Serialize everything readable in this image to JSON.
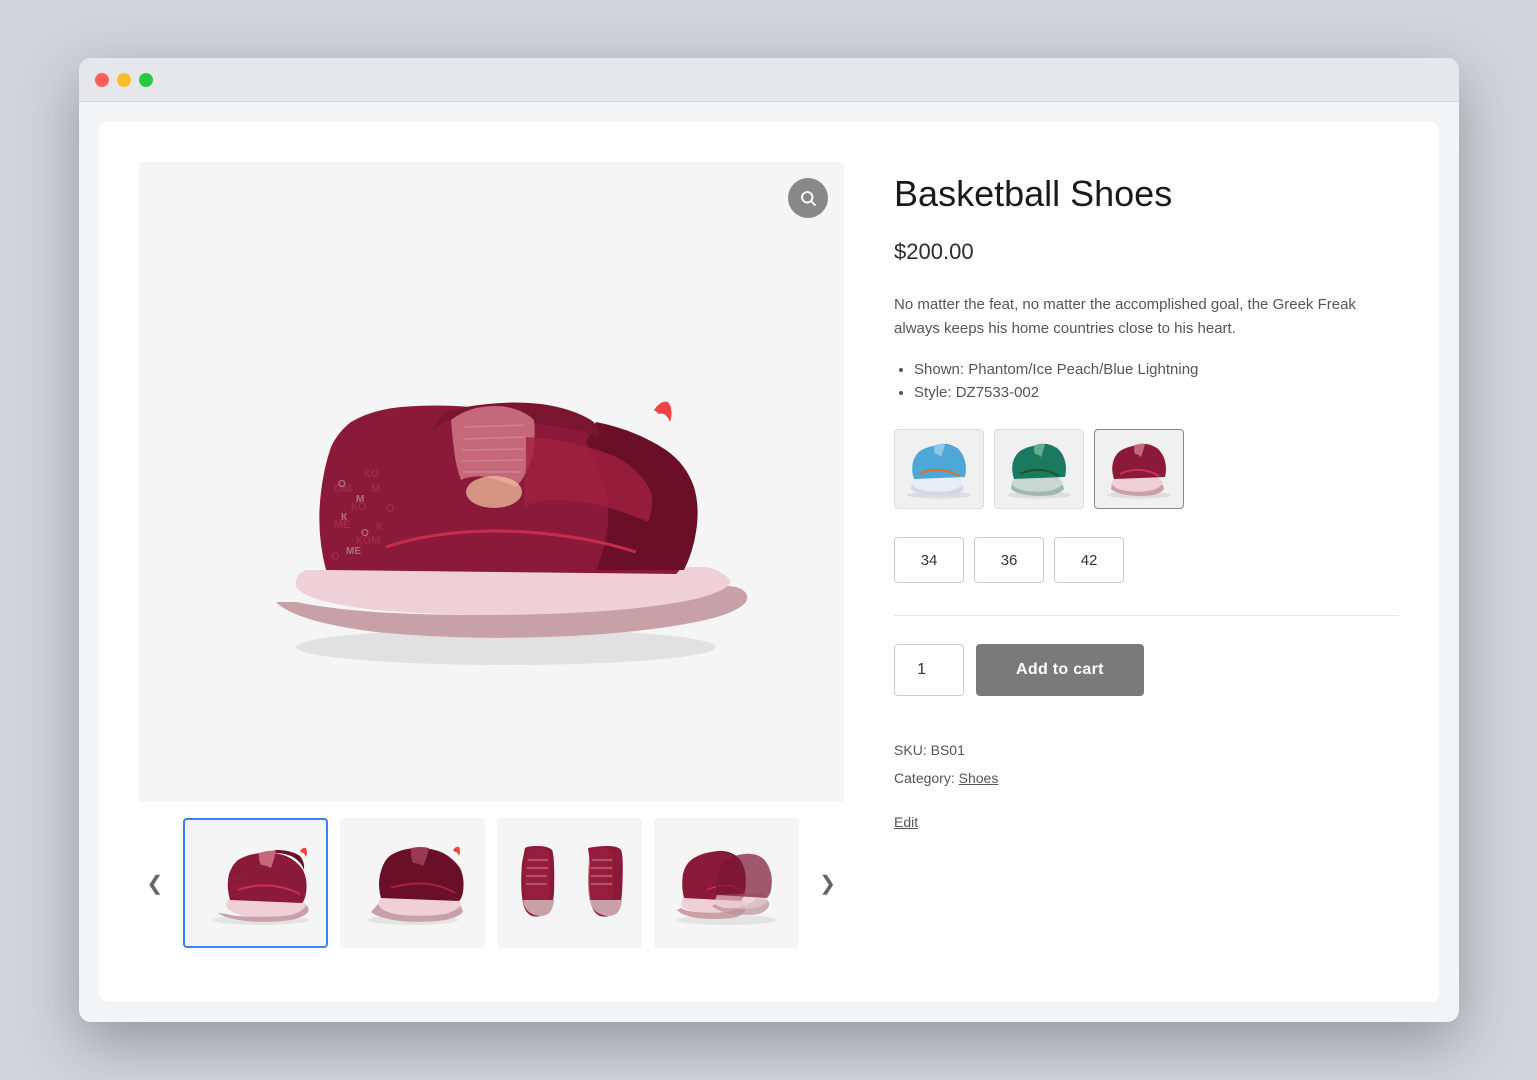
{
  "window": {
    "dots": [
      "red",
      "yellow",
      "green"
    ]
  },
  "product": {
    "title": "Basketball Shoes",
    "price": "$200.00",
    "description": "No matter the feat, no matter the accomplished goal, the Greek Freak always keeps his home countries close to his heart.",
    "details": [
      "Shown: Phantom/Ice Peach/Blue Lightning",
      "Style: DZ7533-002"
    ],
    "colors": [
      {
        "id": "blue",
        "label": "Blue/Orange"
      },
      {
        "id": "teal",
        "label": "Teal/Green"
      },
      {
        "id": "red",
        "label": "Red/Dark Red",
        "active": true
      }
    ],
    "sizes": [
      {
        "value": "34",
        "label": "34"
      },
      {
        "value": "36",
        "label": "36"
      },
      {
        "value": "42",
        "label": "42"
      }
    ],
    "quantity": "1",
    "add_to_cart_label": "Add to cart",
    "sku_label": "SKU:",
    "sku_value": "BS01",
    "category_label": "Category:",
    "category_value": "Shoes",
    "edit_label": "Edit"
  },
  "zoom_icon": "🔍",
  "nav": {
    "prev": "❮",
    "next": "❯"
  }
}
